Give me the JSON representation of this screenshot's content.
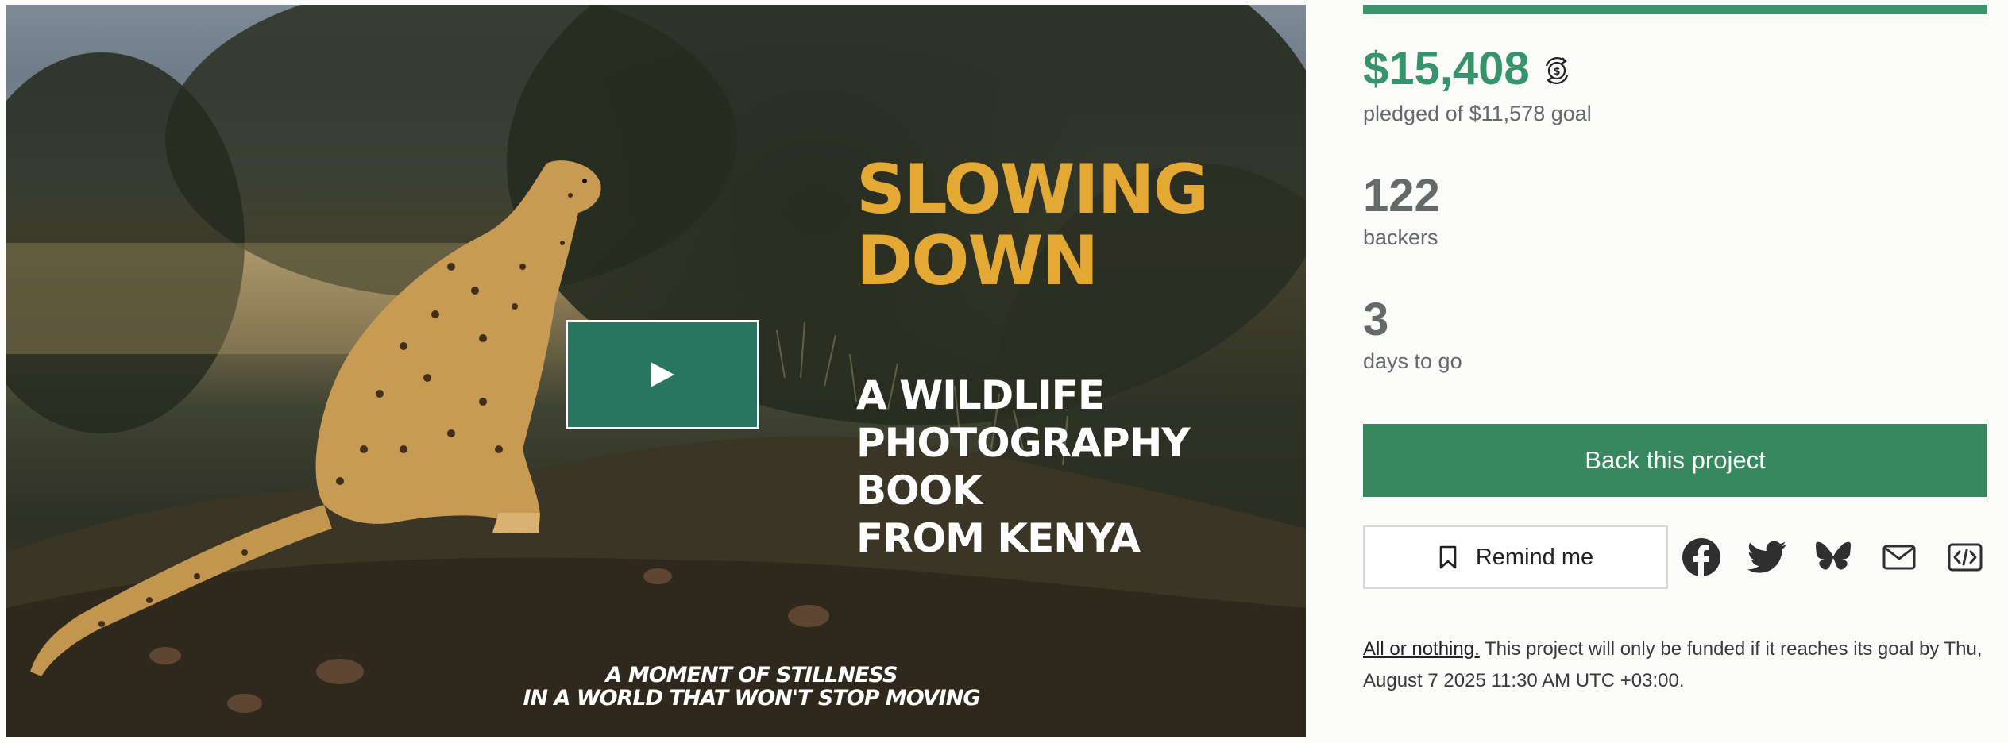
{
  "hero": {
    "title": "SLOWING\nDOWN",
    "subtitle": "A WILDLIFE\nPHOTOGRAPHY\nBOOK\nFROM KENYA",
    "tagline": "A MOMENT OF STILLNESS\nIN A WORLD THAT WON'T STOP MOVING",
    "play_icon": "play-icon"
  },
  "funding": {
    "progress_fraction": 1.0,
    "pledged_amount": "$15,408",
    "currency_icon": "currency-convert-icon",
    "pledged_goal": "pledged of $11,578 goal",
    "backers_count": "122",
    "backers_label": "backers",
    "days_count": "3",
    "days_label": "days to go"
  },
  "actions": {
    "back_label": "Back this project",
    "remind_label": "Remind me",
    "remind_icon": "bookmark-icon",
    "share_icons": [
      "facebook-icon",
      "twitter-icon",
      "bluesky-icon",
      "email-icon",
      "embed-icon"
    ]
  },
  "note": {
    "all_or_nothing": "All or nothing.",
    "text": " This project will only be funded if it reaches its goal by Thu, August 7 2025 11:30 AM UTC +03:00."
  },
  "colors": {
    "accent": "#37946a",
    "button": "#37885e",
    "title_gold": "#e4a934",
    "play": "#2a7560"
  }
}
